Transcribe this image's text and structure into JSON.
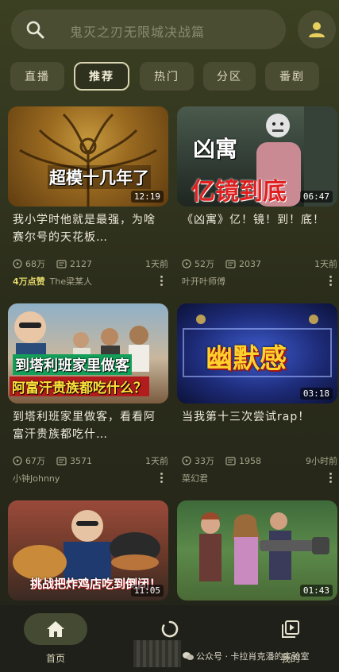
{
  "search": {
    "placeholder": "鬼灭之刃无限城决战篇"
  },
  "tabs": [
    {
      "label": "直播",
      "active": false
    },
    {
      "label": "推荐",
      "active": true
    },
    {
      "label": "热门",
      "active": false
    },
    {
      "label": "分区",
      "active": false
    },
    {
      "label": "番剧",
      "active": false
    }
  ],
  "videos": [
    {
      "thumb_text": "超模十几年了",
      "duration": "12:19",
      "title": "我小学时他就是最强，为啥赛尔号的天花板…",
      "views": "68万",
      "comments": "2127",
      "time": "1天前",
      "badge": "4万点赞",
      "author": "The梁某人"
    },
    {
      "thumb_text_1": "凶寓",
      "thumb_text_2": "亿镜到底",
      "duration": "06:47",
      "title": "《凶寓》亿！镜！到！底！",
      "views": "52万",
      "comments": "2037",
      "time": "1天前",
      "author": "叶开叶师傅"
    },
    {
      "thumb_text_1": "到塔利班家里做客",
      "thumb_text_2": "阿富汗贵族都吃什么？",
      "duration": "",
      "title": "到塔利班家里做客，看看阿富汗贵族都吃什…",
      "views": "67万",
      "comments": "3571",
      "time": "1天前",
      "author": "小钟Johnny"
    },
    {
      "thumb_text": "幽默感",
      "duration": "03:18",
      "title": "当我第十三次尝试rap！",
      "views": "33万",
      "comments": "1958",
      "time": "9小时前",
      "author": "菜幻君"
    },
    {
      "thumb_text": "挑战把炸鸡店吃到倒闭！",
      "duration": "11:05"
    },
    {
      "duration": "01:43"
    }
  ],
  "nav": {
    "home": "首页",
    "dynamic": "",
    "mine": "我的"
  },
  "watermark": "公众号 · 卡拉肖克潘的实验室",
  "colors": {
    "accent": "#e3d769",
    "background": "#2b2d1b",
    "card_red": "#d21c1c"
  }
}
